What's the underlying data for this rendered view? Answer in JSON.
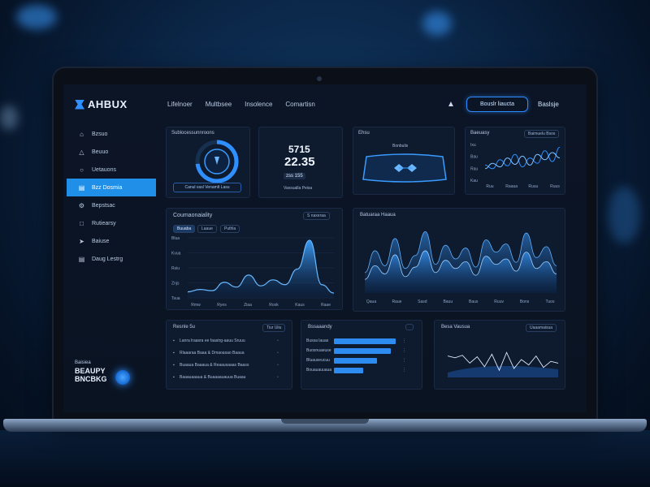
{
  "colors": {
    "accent": "#2f8fff",
    "active_sidebar": "#1f8fe8",
    "card_bg": "#0e1a2e",
    "screen_bg": "#0a1322"
  },
  "header": {
    "logo_text": "AHBUX",
    "nav": [
      "Lifelnoer",
      "Multbsee",
      "Insolence",
      "Comartisn"
    ],
    "cta_label": "Bouslr liaucta",
    "right_label": "Baslsje",
    "bell_icon": "bell-icon"
  },
  "sidebar": {
    "items": [
      {
        "label": "Bzsuo",
        "icon": "home-icon"
      },
      {
        "label": "Beuuo",
        "icon": "chart-icon"
      },
      {
        "label": "Uetauons",
        "icon": "user-icon"
      },
      {
        "label": "Bzz Dosmia",
        "icon": "grid-icon",
        "active": true
      },
      {
        "label": "Bepstsac",
        "icon": "settings-icon"
      },
      {
        "label": "Rutiearsy",
        "icon": "message-icon"
      },
      {
        "label": "Baiuse",
        "icon": "send-icon"
      },
      {
        "label": "Daug Lestrg",
        "icon": "document-icon"
      }
    ],
    "promo": {
      "line1": "Baisiea",
      "line2": "BEAUPY",
      "line3": "BNCBKG"
    }
  },
  "cards": {
    "gauge": {
      "title": "Sublocessunnroons",
      "button": "Canul vasl Venamlt  Lasu"
    },
    "stats": {
      "value1": "5715",
      "value2": "22.35",
      "tag": "zss  155",
      "caption": "Vaxsualla  Peisa"
    },
    "device": {
      "title": "Ehsu",
      "subtitle": "Bonbulis"
    },
    "mini_chart": {
      "title": "Baeuasy",
      "pill": "Baimuelu Bsos"
    },
    "growth": {
      "title": "Coumaonaiality",
      "pill": "S naxeraa",
      "tabs": [
        "Buuaba",
        "Laaue",
        "Puthla"
      ]
    },
    "wave": {
      "title": "Batuaraa Haaua"
    },
    "list": {
      "title": "Resnle 5u",
      "pill": "Tiur Uiiu"
    },
    "bars": {
      "title": "Bssaaandy"
    },
    "line": {
      "title": "Besa Vausua",
      "pill": "Uaaamaisua"
    }
  },
  "chart_data": [
    {
      "type": "area",
      "title": "Coumaonaiality",
      "series": [
        {
          "values": [
            10,
            14,
            12,
            26,
            18,
            38,
            20,
            30,
            22,
            48,
            96,
            22,
            8
          ]
        }
      ],
      "ylim": [
        0,
        100
      ],
      "x_tick_labels": [
        "Rmw",
        "Ryes",
        "Ziaa",
        "Roxk",
        "Kaus",
        "Raae"
      ],
      "y_tick_labels": [
        "Blua",
        "Kvua",
        "Rsiu",
        "Znjs",
        "Tsua"
      ]
    },
    {
      "type": "area",
      "title": "Batuaraa Haaua",
      "series": [
        {
          "values": [
            30,
            62,
            40,
            80,
            36,
            55,
            90,
            42,
            70,
            50,
            66,
            38,
            78,
            60,
            72,
            45,
            88,
            52,
            68,
            40
          ]
        },
        {
          "values": [
            20,
            40,
            28,
            56,
            24,
            38,
            62,
            30,
            48,
            36,
            46,
            26,
            54,
            42,
            50,
            32,
            60,
            36,
            46,
            28
          ]
        }
      ],
      "ylim": [
        0,
        100
      ],
      "x_tick_labels": [
        "Qaua",
        "Raue",
        "Sasd",
        "Bauu",
        "Baus",
        "Ruuv",
        "Bons",
        "Tuos"
      ]
    },
    {
      "type": "line",
      "title": "Baeuasy",
      "series": [
        {
          "values": [
            40,
            30,
            55,
            38,
            70,
            35,
            60,
            45,
            80,
            50,
            90
          ]
        },
        {
          "values": [
            30,
            45,
            35,
            60,
            42,
            65,
            40,
            70,
            55,
            75,
            60
          ]
        }
      ],
      "ylim": [
        0,
        100
      ],
      "x_tick_labels": [
        "Ruu",
        "Raaua",
        "Ruuu",
        "Ruus"
      ],
      "y_tick_labels": [
        "Ixu",
        "Bau",
        "Rau",
        "Kau"
      ]
    },
    {
      "type": "bar",
      "title": "Bssaaandy",
      "categories": [
        "Bussa lauas",
        "Buosnuaeuse",
        "Bluauseucuu",
        "Bouauauuaua"
      ],
      "values": [
        100,
        92,
        70,
        48
      ],
      "ylim": [
        0,
        100
      ],
      "orientation": "horizontal"
    },
    {
      "type": "line",
      "title": "Besa Vausua",
      "series": [
        {
          "values": [
            60,
            55,
            62,
            40,
            58,
            30,
            65,
            20,
            70,
            25,
            50,
            35,
            60,
            28,
            45,
            40
          ]
        }
      ],
      "ylim": [
        0,
        100
      ]
    }
  ],
  "list_rows": [
    "Lanra lraasra ee faastrg-aauu Sruuu",
    "Rlaaaraa Baaa & Dmaoasao Baaua",
    "Buaaua Baaaua & Reaausaaas Baass",
    "Baaauaaaua & Buaaaauauua Buaau"
  ]
}
